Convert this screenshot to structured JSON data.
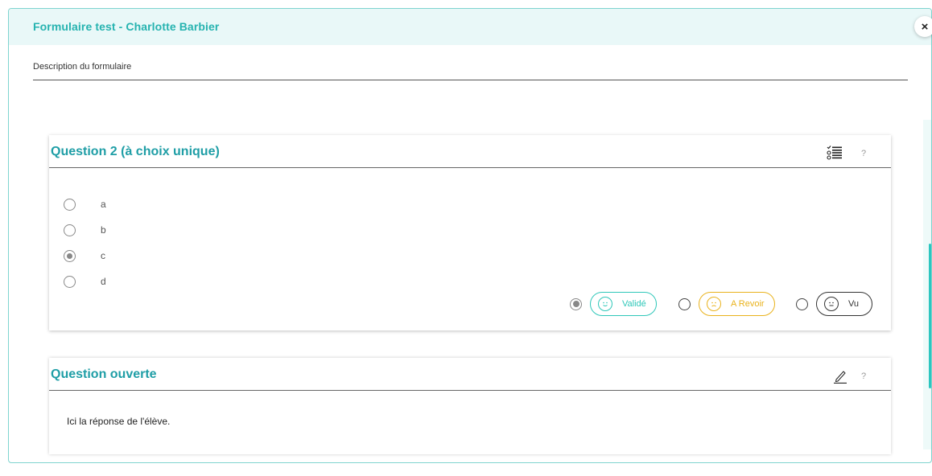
{
  "modal": {
    "title": "Formulaire test - Charlotte Barbier",
    "close_label": "×",
    "description": "Description du formulaire"
  },
  "question1": {
    "title": "Question 2 (à choix unique)",
    "type_icon": "checklist-icon",
    "help": "?",
    "options": [
      {
        "label": "a",
        "checked": false
      },
      {
        "label": "b",
        "checked": false
      },
      {
        "label": "c",
        "checked": true
      },
      {
        "label": "d",
        "checked": false
      }
    ],
    "evaluation": [
      {
        "label": "Validé",
        "checked": true,
        "color": "#2fc7b9",
        "icon": "smile-face-icon"
      },
      {
        "label": "A Revoir",
        "checked": false,
        "color": "#e9b21b",
        "icon": "sad-face-icon"
      },
      {
        "label": "Vu",
        "checked": false,
        "color": "#333333",
        "icon": "neutral-face-icon"
      }
    ]
  },
  "question2": {
    "title": "Question ouverte",
    "type_icon": "pencil-icon",
    "help": "?",
    "answer": "Ici la réponse de l'élève."
  },
  "colors": {
    "accent": "#26b3b0",
    "header_bg": "#e9f8f8"
  }
}
